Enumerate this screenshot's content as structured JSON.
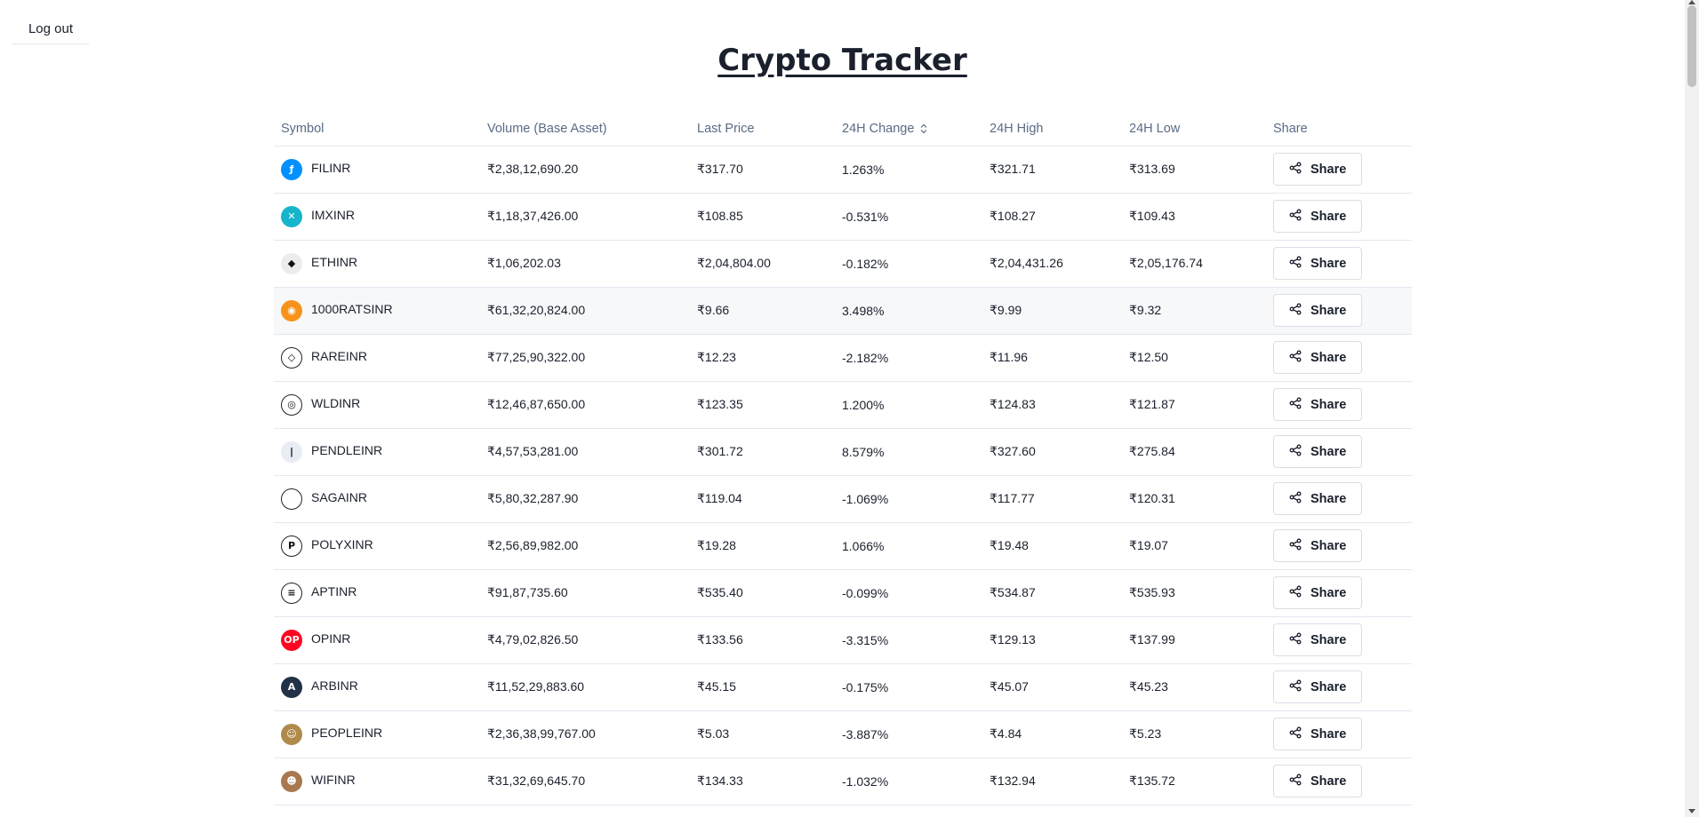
{
  "header": {
    "logout_label": "Log out",
    "title": "Crypto Tracker"
  },
  "table": {
    "columns": [
      "Symbol",
      "Volume (Base Asset)",
      "Last Price",
      "24H Change",
      "24H High",
      "24H Low",
      "Share"
    ],
    "share_label": "Share",
    "rows": [
      {
        "symbol": "FILINR",
        "icon": "filecoin-icon",
        "color": "#0090ff",
        "glyph": "ƒ",
        "volume": "₹2,38,12,690.20",
        "last": "₹317.70",
        "change": "1.263%",
        "high": "₹321.71",
        "low": "₹313.69"
      },
      {
        "symbol": "IMXINR",
        "icon": "immutable-x-icon",
        "color": "#17b5cb",
        "glyph": "✕",
        "volume": "₹1,18,37,426.00",
        "last": "₹108.85",
        "change": "-0.531%",
        "high": "₹108.27",
        "low": "₹109.43"
      },
      {
        "symbol": "ETHINR",
        "icon": "ethereum-icon",
        "color": "#ececec",
        "glyph": "◆",
        "volume": "₹1,06,202.03",
        "last": "₹2,04,804.00",
        "change": "-0.182%",
        "high": "₹2,04,431.26",
        "low": "₹2,05,176.74"
      },
      {
        "symbol": "1000RATSINR",
        "icon": "rats-icon",
        "color": "#f7931a",
        "glyph": "◉",
        "volume": "₹61,32,20,824.00",
        "last": "₹9.66",
        "change": "3.498%",
        "high": "₹9.99",
        "low": "₹9.32"
      },
      {
        "symbol": "RAREINR",
        "icon": "rare-diamond-icon",
        "color": "#ffffff",
        "glyph": "◇",
        "volume": "₹77,25,90,322.00",
        "last": "₹12.23",
        "change": "-2.182%",
        "high": "₹11.96",
        "low": "₹12.50"
      },
      {
        "symbol": "WLDINR",
        "icon": "worldcoin-icon",
        "color": "#ffffff",
        "glyph": "◎",
        "volume": "₹12,46,87,650.00",
        "last": "₹123.35",
        "change": "1.200%",
        "high": "₹124.83",
        "low": "₹121.87"
      },
      {
        "symbol": "PENDLEINR",
        "icon": "pendle-icon",
        "color": "#e8ecf3",
        "glyph": "|",
        "volume": "₹4,57,53,281.00",
        "last": "₹301.72",
        "change": "8.579%",
        "high": "₹327.60",
        "low": "₹275.84"
      },
      {
        "symbol": "SAGAINR",
        "icon": "saga-icon",
        "color": "#ffffff",
        "glyph": "",
        "volume": "₹5,80,32,287.90",
        "last": "₹119.04",
        "change": "-1.069%",
        "high": "₹117.77",
        "low": "₹120.31"
      },
      {
        "symbol": "POLYXINR",
        "icon": "polymesh-icon",
        "color": "#ffffff",
        "glyph": "P",
        "volume": "₹2,56,89,982.00",
        "last": "₹19.28",
        "change": "1.066%",
        "high": "₹19.48",
        "low": "₹19.07"
      },
      {
        "symbol": "APTINR",
        "icon": "aptos-icon",
        "color": "#ffffff",
        "glyph": "≡",
        "volume": "₹91,87,735.60",
        "last": "₹535.40",
        "change": "-0.099%",
        "high": "₹534.87",
        "low": "₹535.93"
      },
      {
        "symbol": "OPINR",
        "icon": "optimism-icon",
        "color": "#ff0420",
        "glyph": "OP",
        "volume": "₹4,79,02,826.50",
        "last": "₹133.56",
        "change": "-3.315%",
        "high": "₹129.13",
        "low": "₹137.99"
      },
      {
        "symbol": "ARBINR",
        "icon": "arbitrum-icon",
        "color": "#213147",
        "glyph": "A",
        "volume": "₹11,52,29,883.60",
        "last": "₹45.15",
        "change": "-0.175%",
        "high": "₹45.07",
        "low": "₹45.23"
      },
      {
        "symbol": "PEOPLEINR",
        "icon": "people-icon",
        "color": "#b08a4a",
        "glyph": "☺",
        "volume": "₹2,36,38,99,767.00",
        "last": "₹5.03",
        "change": "-3.887%",
        "high": "₹4.84",
        "low": "₹5.23"
      },
      {
        "symbol": "WIFINR",
        "icon": "dogwifhat-icon",
        "color": "#a9784f",
        "glyph": "☻",
        "volume": "₹31,32,69,645.70",
        "last": "₹134.33",
        "change": "-1.032%",
        "high": "₹132.94",
        "low": "₹135.72"
      }
    ]
  }
}
